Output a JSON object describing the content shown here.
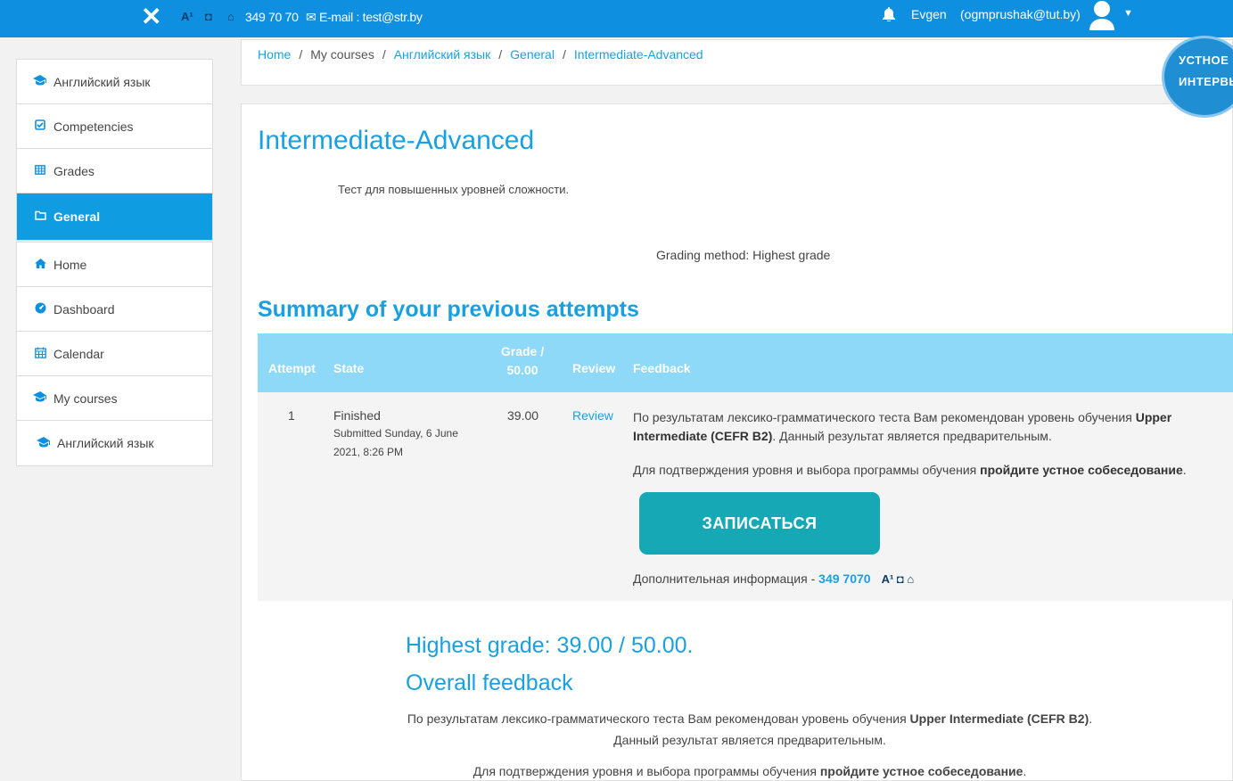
{
  "topbar": {
    "close_icon": "✕",
    "acc_icons": [
      "A¹",
      "◘",
      "⌂"
    ],
    "phone": "349 70 70",
    "email": "✉ E-mail : test@str.by",
    "user_name": "Evgen",
    "user_email": "(ogmprushak@tut.by)"
  },
  "sidebar": {
    "group1": [
      {
        "icon": "graduation-cap-icon",
        "glyph": "🎓",
        "label": "Английский язык"
      },
      {
        "icon": "check-square-icon",
        "glyph": "☑",
        "label": "Competencies"
      },
      {
        "icon": "table-icon",
        "glyph": "▦",
        "label": "Grades"
      },
      {
        "icon": "folder-icon",
        "glyph": "☐",
        "label": "General"
      }
    ],
    "group2": [
      {
        "icon": "home-icon",
        "glyph": "⌂",
        "label": "Home"
      },
      {
        "icon": "dashboard-icon",
        "glyph": "◉",
        "label": "Dashboard"
      },
      {
        "icon": "calendar-icon",
        "glyph": "▦",
        "label": "Calendar"
      },
      {
        "icon": "graduation-cap-icon",
        "glyph": "🎓",
        "label": "My courses"
      },
      {
        "icon": "graduation-cap-icon",
        "glyph": "🎓",
        "label": "Английский язык"
      }
    ]
  },
  "breadcrumb": {
    "home": "Home",
    "my_courses": "My courses",
    "course": "Английский язык",
    "section": "General",
    "current": "Intermediate-Advanced"
  },
  "badge": {
    "line1": "УСТНОЕ",
    "line2": "ИНТЕРВЬЮ"
  },
  "main": {
    "title": "Intermediate-Advanced",
    "intro": "Тест для повышенных уровней сложности.",
    "grading": "Grading method: Highest grade",
    "summary_title": "Summary of your previous attempts"
  },
  "table": {
    "headers": {
      "attempt": "Attempt",
      "state": "State",
      "grade_line1": "Grade /",
      "grade_line2": "50.00",
      "review": "Review",
      "feedback": "Feedback"
    },
    "row": {
      "attempt": "1",
      "state": "Finished",
      "submitted_line1": "Submitted Sunday, 6 June",
      "submitted_line2": "2021, 8:26 PM",
      "grade": "39.00",
      "review": "Review",
      "fb_text1": "По результатам лексико-грамматического теста Вам рекомендован уровень обучения ",
      "fb_bold1": "Upper Intermediate (CEFR B2)",
      "fb_text1b": ". Данный результат является предварительным.",
      "fb_text2": "Для подтверждения уровня и выбора программы обучения ",
      "fb_bold2": "пройдите устное собеседование",
      "fb_text2b": ".",
      "button": "ЗАПИСАТЬСЯ",
      "more_info": "Дополнительная информация - ",
      "more_phone": "349 7070",
      "more_icons": "A¹ ◘ ⌂"
    }
  },
  "results": {
    "highest": "Highest grade: 39.00 / 50.00.",
    "overall": "Overall feedback",
    "ofb_text1": "По результатам лексико-грамматического теста Вам рекомендован уровень обучения ",
    "ofb_bold1": "Upper Intermediate (CEFR B2)",
    "ofb_text1b": ". Данный результат является предварительным.",
    "ofb_text2": "Для подтверждения уровня и выбора программы обучения ",
    "ofb_bold2": "пройдите устное собеседование",
    "ofb_text2b": "."
  }
}
